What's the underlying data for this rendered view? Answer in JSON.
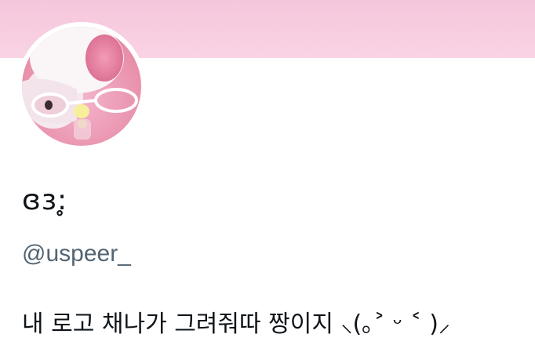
{
  "profile": {
    "display_name": "ɞɜ:̥",
    "handle": "@uspeer_",
    "bio": "내 로고 채나가 그려줘따 짱이지 ⸜(｡˃ ᵕ ˂ )⸝",
    "avatar_icon": "pink-plush-toy-with-glasses",
    "banner_color": "#f8cde1"
  }
}
